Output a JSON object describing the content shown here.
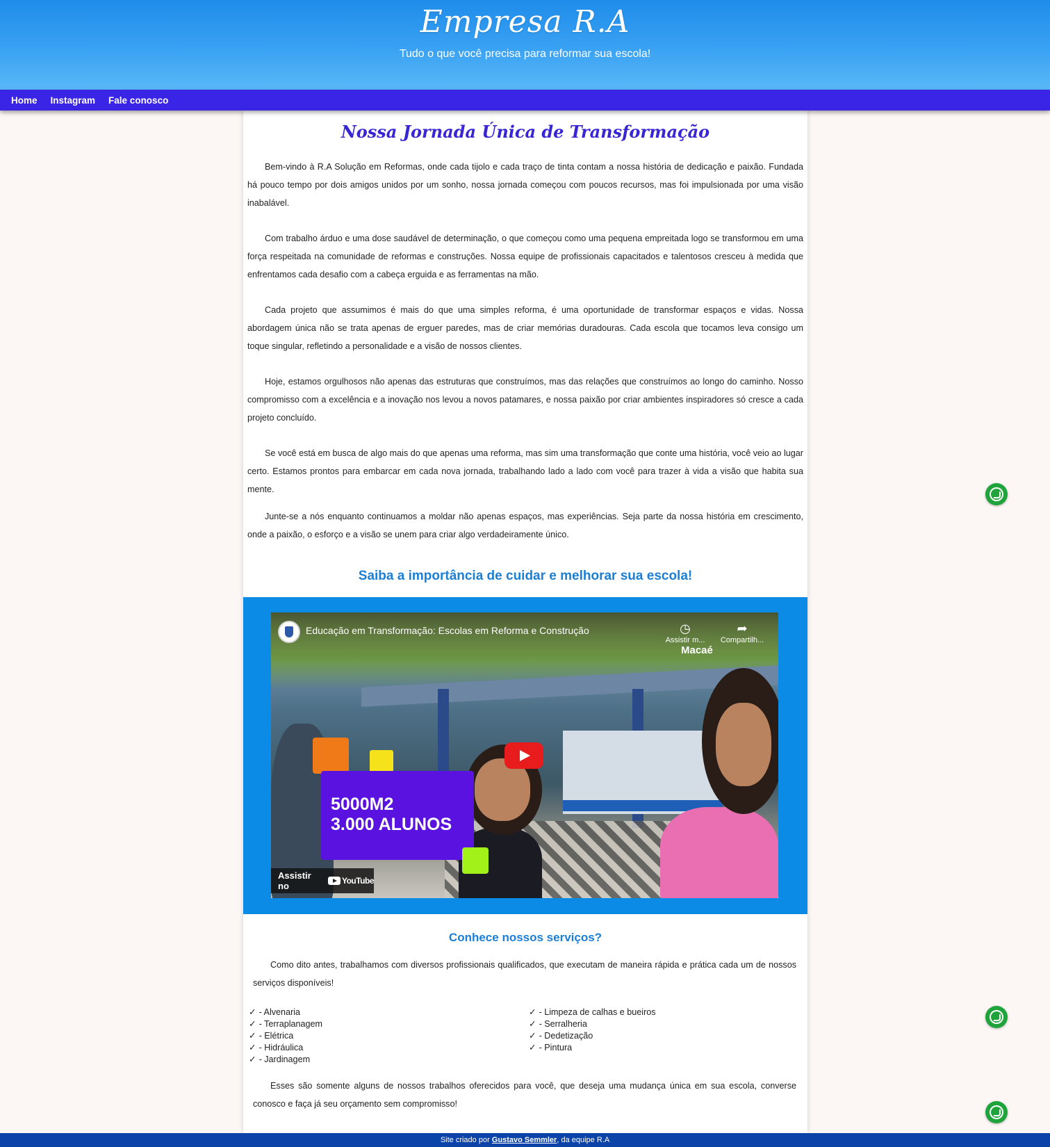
{
  "header": {
    "brand": "Empresa R.A",
    "tagline": "Tudo o que você precisa para reformar sua escola!"
  },
  "nav": {
    "items": [
      "Home",
      "Instagram",
      "Fale conosco"
    ]
  },
  "story": {
    "title": "Nossa Jornada Única de Transformação",
    "paragraphs": [
      "Bem-vindo à R.A Solução em Reformas, onde cada tijolo e cada traço de tinta contam a nossa história de dedicação e paixão. Fundada há pouco tempo por dois amigos unidos por um sonho, nossa jornada começou com poucos recursos, mas foi impulsionada por uma visão inabalável.",
      "Com trabalho árduo e uma dose saudável de determinação, o que começou como uma pequena empreitada logo se transformou em uma força respeitada na comunidade de reformas e construções. Nossa equipe de profissionais capacitados e talentosos cresceu à medida que enfrentamos cada desafio com a cabeça erguida e as ferramentas na mão.",
      "Cada projeto que assumimos é mais do que uma simples reforma, é uma oportunidade de transformar espaços e vidas. Nossa abordagem única não se trata apenas de erguer paredes, mas de criar memórias duradouras. Cada escola que tocamos leva consigo um toque singular, refletindo a personalidade e a visão de nossos clientes.",
      "Hoje, estamos orgulhosos não apenas das estruturas que construímos, mas das relações que construímos ao longo do caminho. Nosso compromisso com a excelência e a inovação nos levou a novos patamares, e nossa paixão por criar ambientes inspiradores só cresce a cada projeto concluído.",
      "Se você está em busca de algo mais do que apenas uma reforma, mas sim uma transformação que conte uma história, você veio ao lugar certo. Estamos prontos para embarcar em cada nova jornada, trabalhando lado a lado com você para trazer à vida a visão que habita sua mente.",
      "Junte-se a nós enquanto continuamos a moldar não apenas espaços, mas experiências. Seja parte da nossa história em crescimento, onde a paixão, o esforço e a visão se unem para criar algo verdadeiramente único."
    ]
  },
  "video_section": {
    "heading": "Saiba a importância de cuidar e melhorar sua escola!",
    "video": {
      "title": "Educação em Transformação: Escolas em Reforma e Construção",
      "watch_later_label": "Assistir m...",
      "share_label": "Compartilh...",
      "channel_brand": "Macaé",
      "overlay_line1": "5000M2",
      "overlay_line2": "3.000 ALUNOS",
      "watch_on_label": "Assistir no",
      "youtube_label": "YouTube",
      "icons": [
        "clock-icon",
        "share-icon",
        "play-icon",
        "youtube-icon"
      ]
    }
  },
  "services": {
    "heading": "Conhece nossos serviços?",
    "intro": "Como dito antes, trabalhamos com diversos profissionais qualificados, que executam de maneira rápida e prática cada um de nossos serviços disponíveis!",
    "check": "✓",
    "column_left": [
      "- Alvenaria",
      "- Terraplanagem",
      "- Elétrica",
      "- Hidráulica",
      "- Jardinagem"
    ],
    "column_right": [
      "- Limpeza de calhas e bueiros",
      "- Serralheria",
      "- Dedetização",
      "- Pintura"
    ],
    "outro": "Esses são somente alguns de nossos trabalhos oferecidos para você, que deseja uma mudança única em sua escola, converse conosco e faça já seu orçamento sem compromisso!"
  },
  "footer": {
    "prefix": "Site criado por",
    "author": "Gustavo Semmler",
    "suffix": ", da equipe R.A"
  },
  "floating": {
    "whatsapp_icon": "whatsapp-icon"
  },
  "colors": {
    "header_gradient_top": "#1e8cea",
    "nav_bg": "#3a24e6",
    "accent_blue": "#1b7fd6",
    "title_purple": "#3826d4",
    "video_band": "#0b8ae6",
    "footer_bg": "#0c43a8",
    "whatsapp_green": "#1ea43a"
  }
}
